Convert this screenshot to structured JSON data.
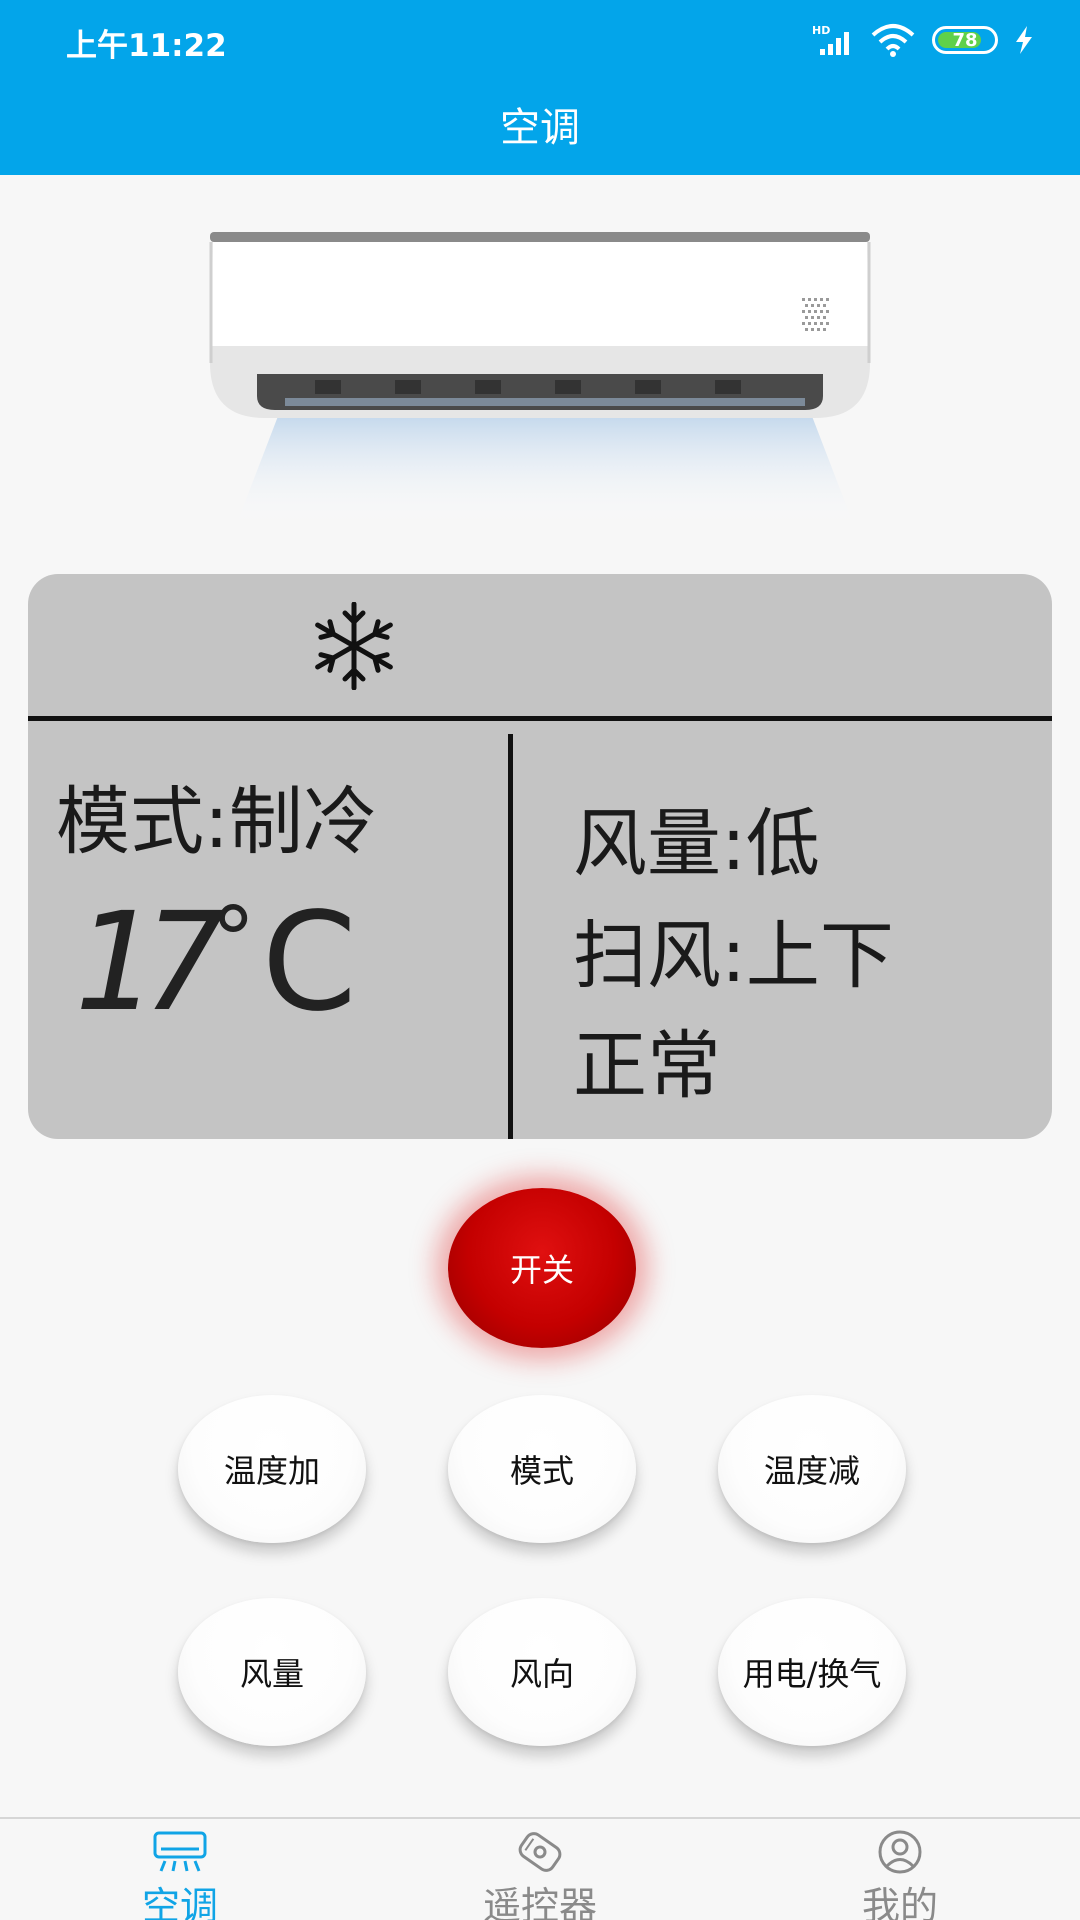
{
  "status_bar": {
    "time": "上午11:22",
    "battery": "78"
  },
  "header": {
    "title": "空调"
  },
  "display": {
    "mode": "模式:制冷",
    "temperature": "17",
    "temperature_unit": "°",
    "temperature_c": "C",
    "wind": "风量:低",
    "swing": "扫风:上下",
    "state": "正常"
  },
  "controls": {
    "power": "开关",
    "temp_up": "温度加",
    "mode": "模式",
    "temp_down": "温度减",
    "wind": "风量",
    "direction": "风向",
    "power_vent": "用电/换气"
  },
  "nav": {
    "items": [
      {
        "label": "空调",
        "icon": "air-conditioner-icon",
        "active": true
      },
      {
        "label": "遥控器",
        "icon": "remote-control-icon",
        "active": false
      },
      {
        "label": "我的",
        "icon": "profile-icon",
        "active": false
      }
    ]
  },
  "colors": {
    "accent": "#03a5ea",
    "power": "#c40000",
    "panel": "#c4c4c4"
  }
}
